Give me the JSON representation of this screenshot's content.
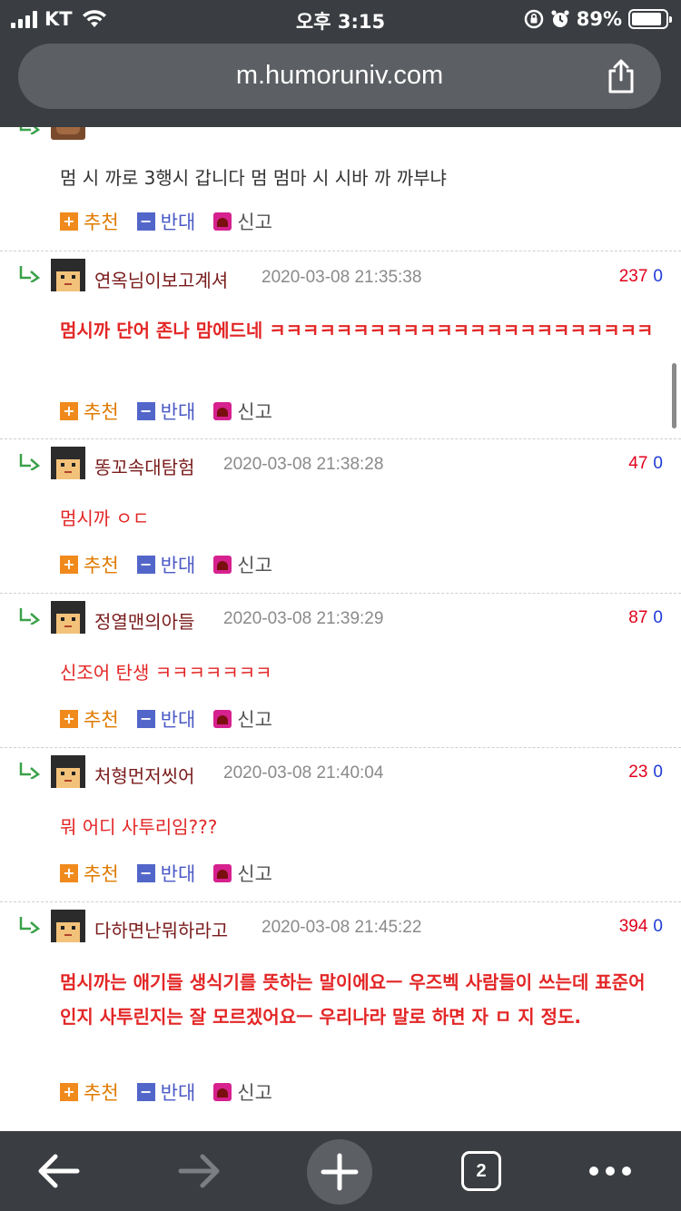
{
  "status_bar": {
    "carrier": "KT",
    "time": "오후 3:15",
    "battery": "89%",
    "battery_level": 0.89
  },
  "browser": {
    "url": "m.humoruniv.com",
    "tab_count": "2",
    "icons": {
      "share": "share-icon",
      "back": "back-arrow-icon",
      "forward": "forward-arrow-icon",
      "new_tab": "plus-icon",
      "menu": "more-icon"
    }
  },
  "colors": {
    "chrome": "#3a3d41",
    "nick": "#7a1b1b",
    "comment_red": "#e32626",
    "vote_up": "#e0001b",
    "vote_down": "#1f3bd6",
    "recommend": "#e07a00",
    "oppose": "#4a59c6"
  },
  "actions": {
    "recommend": "추천",
    "oppose": "반대",
    "report": "신고"
  },
  "partial_comment": {
    "text": "멈 시 까로 3행시 갑니다 멈 멈마 시 시바 까 까부냐"
  },
  "comments": [
    {
      "nick": "연옥님이보고계셔",
      "date": "2020-03-08 21:35:38",
      "up": "237",
      "down": "0",
      "text": "멈시까 단어 존나 맘에드네 ㅋㅋㅋㅋㅋㅋㅋㅋㅋㅋㅋㅋㅋㅋㅋㅋㅋㅋㅋㅋㅋㅋㅋ"
    },
    {
      "nick": "똥꼬속대탐험",
      "date": "2020-03-08 21:38:28",
      "up": "47",
      "down": "0",
      "text": "멈시까 ㅇㄷ"
    },
    {
      "nick": "정열맨의아들",
      "date": "2020-03-08 21:39:29",
      "up": "87",
      "down": "0",
      "text": "신조어 탄생 ㅋㅋㅋㅋㅋㅋㅋ"
    },
    {
      "nick": "처형먼저씻어",
      "date": "2020-03-08 21:40:04",
      "up": "23",
      "down": "0",
      "text": "뭐 어디 사투리임???"
    },
    {
      "nick": "다하면난뭐하라고",
      "date": "2020-03-08 21:45:22",
      "up": "394",
      "down": "0",
      "text": "멈시까는 애기들 생식기를 뜻하는 말이에요ㅡ 우즈벡 사람들이 쓰는데 표준어인지 사투린지는 잘 모르겠어요ㅡ 우리나라 말로 하면 자 ㅁ 지 정도."
    }
  ]
}
